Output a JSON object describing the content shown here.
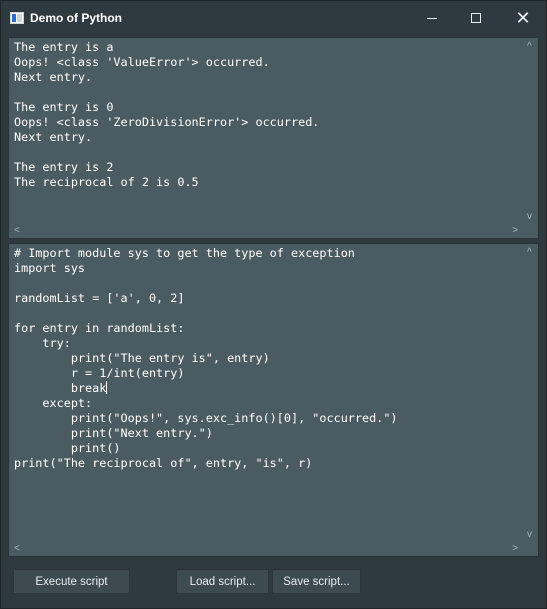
{
  "window": {
    "title": "Demo of Python",
    "minimize_glyph": "—",
    "close_glyph": "✕"
  },
  "output": {
    "text": "The entry is a\nOops! <class 'ValueError'> occurred.\nNext entry.\n\nThe entry is 0\nOops! <class 'ZeroDivisionError'> occurred.\nNext entry.\n\nThe entry is 2\nThe reciprocal of 2 is 0.5"
  },
  "editor": {
    "text_before_caret": "# Import module sys to get the type of exception\nimport sys\n\nrandomList = ['a', 0, 2]\n\nfor entry in randomList:\n    try:\n        print(\"The entry is\", entry)\n        r = 1/int(entry)\n        break",
    "text_after_caret": "\n    except:\n        print(\"Oops!\", sys.exc_info()[0], \"occurred.\")\n        print(\"Next entry.\")\n        print()\nprint(\"The reciprocal of\", entry, \"is\", r)"
  },
  "scroll": {
    "up": "^",
    "down": "v",
    "left": "<",
    "right": ">"
  },
  "buttons": {
    "execute": "Execute script",
    "load": "Load script...",
    "save": "Save script..."
  },
  "colors": {
    "window_bg": "#2f3a40",
    "panel_bg": "#4a5b62",
    "button_bg": "#3d4a50",
    "text": "#ffffff"
  },
  "icons": {
    "app": "python-app-icon",
    "minimize": "minimize-icon",
    "maximize": "maximize-icon",
    "close": "close-icon"
  }
}
